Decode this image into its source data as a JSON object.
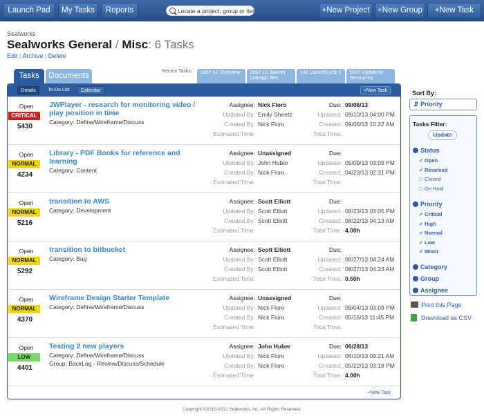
{
  "topbar": {
    "launch_pad": "Launch Pad",
    "my_tasks": "My Tasks",
    "reports": "Reports",
    "search_placeholder": "Locate a project, group or iter",
    "new_project": "+New Project",
    "new_group": "+New Group",
    "new_task": "+New Task"
  },
  "header": {
    "org": "Sealworks",
    "title": "Sealworks General",
    "separator": "/",
    "title_rest": "Misc",
    "count": ": 6 Tasks",
    "links": {
      "edit": "Edit",
      "archive": "Archive",
      "delete": "Delete",
      "divider": "|"
    }
  },
  "tabs": {
    "tasks": "Tasks",
    "documents": "Documents"
  },
  "recent": {
    "label": "Recent Tasks:",
    "items": [
      "1957 LC Overview",
      "2087 LC Banner indesign files",
      "142 LaunchCycle 2",
      "5547 Update to Resources"
    ]
  },
  "subtabs": {
    "details": "Details",
    "todo": "To-Do List",
    "calendar": "Calendar",
    "new_task": "+New Task"
  },
  "labels": {
    "assignee": "Assignee:",
    "updated_by": "Updated By:",
    "created_by": "Created By:",
    "estimated_time": "Estimated Time:",
    "due": "Due:",
    "updated": "Updated:",
    "created": "Created:",
    "total_time": "Total Time:"
  },
  "tasks": [
    {
      "status": "Open",
      "priority": "CRITICAL",
      "priority_color": "#c62323",
      "id": "5430",
      "title": "JWPlayer - research for monitoring video / play position in time",
      "category": "Category: Define/Wireframe/Discuss",
      "group": "",
      "assignee": "Nick Floro",
      "updated_by": "Emily Sheetz",
      "created_by": "Nick Floro",
      "estimated_time": "",
      "due": "09/06/13",
      "updated": "09/10/13 04:00 PM",
      "created": "09/06/13 10:22 AM",
      "total_time": ""
    },
    {
      "status": "Open",
      "priority": "NORMAL",
      "priority_color": "#f2d600",
      "id": "4234",
      "title": "Library - PDF Books for reference and learning",
      "category": "Category: Content",
      "group": "",
      "assignee": "Unassigned",
      "updated_by": "John Huber",
      "created_by": "Nick Floro",
      "estimated_time": "",
      "due": "",
      "updated": "05/09/13 03:09 PM",
      "created": "04/23/13 02:31 PM",
      "total_time": ""
    },
    {
      "status": "Open",
      "priority": "NORMAL",
      "priority_color": "#f2d600",
      "id": "5216",
      "title": "transition to AWS",
      "category": "Category: Development",
      "group": "",
      "assignee": "Scott Elliott",
      "updated_by": "Scott Elliott",
      "created_by": "Scott Elliott",
      "estimated_time": "",
      "due": "",
      "updated": "08/23/13 03:05 PM",
      "created": "08/22/13 04:13 AM",
      "total_time": "4.00h"
    },
    {
      "status": "Open",
      "priority": "NORMAL",
      "priority_color": "#f2d600",
      "id": "5292",
      "title": "transition to bitbucket",
      "category": "Category: Bug",
      "group": "",
      "assignee": "Scott Elliott",
      "updated_by": "Scott Elliott",
      "created_by": "Scott Elliott",
      "estimated_time": "",
      "due": "",
      "updated": "08/27/13 04:24 AM",
      "created": "08/27/13 04:23 AM",
      "total_time": "0.50h"
    },
    {
      "status": "Open",
      "priority": "NORMAL",
      "priority_color": "#f2d600",
      "id": "4370",
      "title": "Wireframe Design Starter Template",
      "category": "Category: Define/Wireframe/Discuss",
      "group": "",
      "assignee": "Unassigned",
      "updated_by": "Nick Floro",
      "created_by": "Nick Floro",
      "estimated_time": "",
      "due": "",
      "updated": "09/04/13 03:09 PM",
      "created": "05/16/13 11:45 PM",
      "total_time": ""
    },
    {
      "status": "Open",
      "priority": "LOW",
      "priority_color": "#7cd56a",
      "id": "4401",
      "title": "Testing 2 new players",
      "category": "Category: Define/Wireframe/Discuss",
      "group": "Group: BackLog - Review/Discuss/Schedule",
      "assignee": "John Huber",
      "updated_by": "Nick Floro",
      "created_by": "Nick Floro",
      "estimated_time": "",
      "due": "06/28/13",
      "updated": "06/10/13 09:21 AM",
      "created": "05/22/13 03:18 PM",
      "total_time": "4.00h"
    }
  ],
  "panel_new_task": "+New Task",
  "sidebar": {
    "sort_by": "Sort By:",
    "sort_value": "Priority",
    "filter_title": "Tasks Filter:",
    "update": "Update",
    "status_head": "Status",
    "status_items": [
      {
        "label": "Open",
        "checked": true
      },
      {
        "label": "Resolved",
        "checked": true
      },
      {
        "label": "Closed",
        "checked": false
      },
      {
        "label": "On Hold",
        "checked": false
      }
    ],
    "priority_head": "Priority",
    "priority_items": [
      {
        "label": "Critical",
        "checked": true
      },
      {
        "label": "High",
        "checked": true
      },
      {
        "label": "Normal",
        "checked": true
      },
      {
        "label": "Low",
        "checked": true
      },
      {
        "label": "Minor",
        "checked": true
      }
    ],
    "category_head": "Category",
    "group_head": "Group",
    "assignee_head": "Assignee",
    "print": "Print this Page",
    "csv": "Download as CSV"
  },
  "footer": "Copyright ©2010-2012 Sealworks, Inc. All Rights Reserved."
}
